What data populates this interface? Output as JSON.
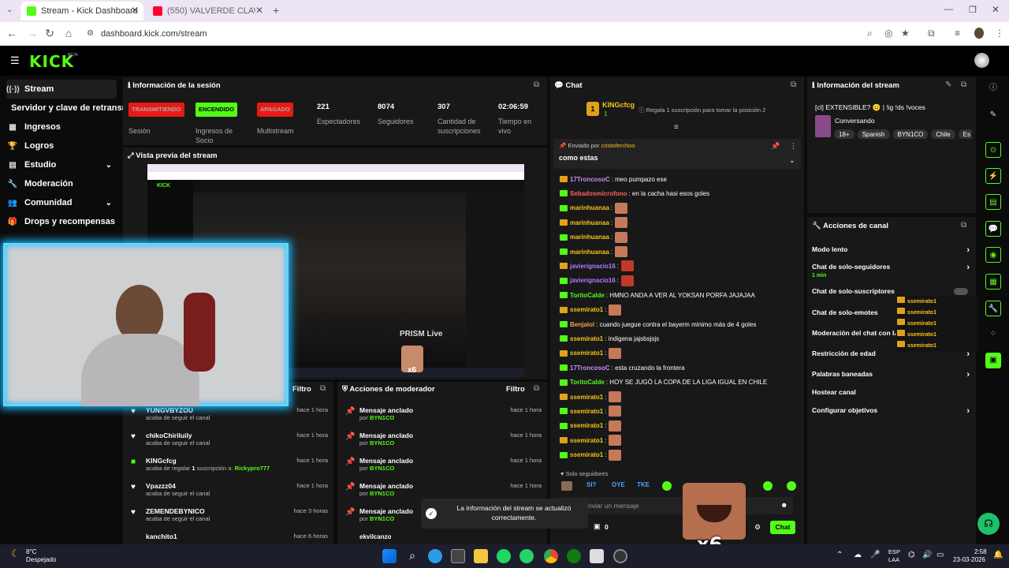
{
  "browser": {
    "tabs": [
      {
        "title": "Stream - Kick Dashboard",
        "active": true
      },
      {
        "title": "(550) VALVERDE CLAVÓ UN GO",
        "active": false
      }
    ],
    "url": "dashboard.kick.com/stream"
  },
  "brand": {
    "logo": "KICK",
    "beta": "BETA",
    "accent": "#53fc18"
  },
  "sidebar": {
    "items": [
      {
        "label": "Stream",
        "icon": "broadcast-icon"
      },
      {
        "label": "Servidor y clave de retransm",
        "icon": ""
      },
      {
        "label": "Ingresos",
        "icon": "grid-icon"
      },
      {
        "label": "Logros",
        "icon": "trophy-icon"
      },
      {
        "label": "Estudio",
        "icon": "studio-icon"
      },
      {
        "label": "Moderación",
        "icon": "wrench-icon"
      },
      {
        "label": "Comunidad",
        "icon": "community-icon"
      },
      {
        "label": "Drops y recompensas",
        "icon": "gift-icon"
      }
    ]
  },
  "session": {
    "title": "Información de la sesión",
    "stats": [
      {
        "badge": "TRANSMITIENDO",
        "badge_color": "#e91916",
        "label": "Sesión"
      },
      {
        "badge": "ENCENDIDO",
        "badge_color": "#53fc18",
        "label": "Ingresos de Socio"
      },
      {
        "badge": "APAGADO",
        "badge_color": "#e91916",
        "label": "Multistream"
      },
      {
        "value": "221",
        "label": "Espectadores"
      },
      {
        "value": "8074",
        "label": "Seguidores"
      },
      {
        "value": "307",
        "label": "Cantidad de suscripciones"
      },
      {
        "value": "02:06:59",
        "label": "Tiempo en vivo"
      }
    ]
  },
  "preview": {
    "title": "Vista previa del stream",
    "watermark": "PRISM Live",
    "emote_overlay": "x6"
  },
  "activity": {
    "filter_label": "Filtro",
    "items": [
      {
        "name": "YUNGVBYZOU",
        "text": "acaba de seguir el canal",
        "time": "hace 1 hora",
        "icon": "heart-icon"
      },
      {
        "name": "chikoChiriluily",
        "text": "acaba de seguir el canal",
        "time": "hace 1 hora",
        "icon": "heart-icon"
      },
      {
        "name": "KINGcfcg",
        "text": "acaba de regalar",
        "count": "1",
        "text2": "suscripción a:",
        "target": "Rickypro777",
        "time": "hace 1 hora",
        "icon": "gift-icon"
      },
      {
        "name": "Vpazzz04",
        "text": "acaba de seguir el canal",
        "time": "hace 1 hora",
        "icon": "heart-icon"
      },
      {
        "name": "ZEMENDEBYNICO",
        "text": "acaba de seguir el canal",
        "time": "hace 3 horas",
        "icon": "heart-icon"
      },
      {
        "name": "kanchito1",
        "text": "",
        "time": "hace 6 horas",
        "icon": "heart-icon"
      }
    ]
  },
  "mod_actions": {
    "title": "Acciones de moderador",
    "filter_label": "Filtro",
    "items": [
      {
        "action": "Mensaje anclado",
        "by": "por",
        "mod": "BYN1CO",
        "time": "hace 1 hora"
      },
      {
        "action": "Mensaje anclado",
        "by": "por",
        "mod": "BYN1CO",
        "time": "hace 1 hora"
      },
      {
        "action": "Mensaje anclado",
        "by": "por",
        "mod": "BYN1CO",
        "time": "hace 1 hora"
      },
      {
        "action": "Mensaje anclado",
        "by": "por",
        "mod": "BYN1CO",
        "time": "hace 1 hora"
      },
      {
        "action": "Mensaje anclado",
        "by": "por",
        "mod": "BYN1CO",
        "time": "hace 1 hora"
      },
      {
        "action": "",
        "by": "",
        "mod": "",
        "time": ""
      }
    ],
    "partial_user": "ekvilcanzo"
  },
  "chat": {
    "title": "Chat",
    "gifter": "KINGcfcg",
    "gifter_count": "1",
    "gift_prompt": "Regala 1 suscripción para tomar la posición 2",
    "pinned_label": "Enviado por",
    "pinned_user": "cristoferchoo",
    "pinned_text": "como estas",
    "messages": [
      {
        "user": "17TroncosoC",
        "color": "#c98cff",
        "text": ": meo pumpazo ese",
        "emote": false
      },
      {
        "user": "Sebadosmicrofono",
        "color": "#ff5f5f",
        "text": ": en la cacha hasi esos goles",
        "emote": false
      },
      {
        "user": "marinhuanaa",
        "color": "#f5c518",
        "text": ":",
        "emote": true
      },
      {
        "user": "marinhuanaa",
        "color": "#f5c518",
        "text": ":",
        "emote": true
      },
      {
        "user": "marinhuanaa",
        "color": "#f5c518",
        "text": ":",
        "emote": true
      },
      {
        "user": "marinhuanaa",
        "color": "#f5c518",
        "text": ":",
        "emote": true
      },
      {
        "user": "javierignacio16",
        "color": "#b27bff",
        "text": ":",
        "emote": true
      },
      {
        "user": "javierignacio16",
        "color": "#b27bff",
        "text": ":",
        "emote": true
      },
      {
        "user": "ToritoCalde",
        "color": "#53fc18",
        "text": ": HMNO ANDA A VER AL YOKSAN PORFA JAJAJAA",
        "emote": false
      },
      {
        "user": "ssemirato1",
        "color": "#f5c518",
        "text": ":",
        "emote": true
      },
      {
        "user": "Benjalol",
        "color": "#ff9f43",
        "text": ": cuando juegue contra el bayerm minimo más de 4 goles",
        "emote": false
      },
      {
        "user": "ssemirato1",
        "color": "#f5c518",
        "text": ": indigena jajsbsjsjs",
        "emote": false
      },
      {
        "user": "ssemirato1",
        "color": "#f5c518",
        "text": ":",
        "emote": true
      },
      {
        "user": "17TroncosoC",
        "color": "#c98cff",
        "text": ": esta cruzando la frontera",
        "emote": false
      },
      {
        "user": "ToritoCalde",
        "color": "#53fc18",
        "text": ": HOY SE JUGÓ LA COPA DE LA LIGA IGUAL EN CHILE",
        "emote": false
      },
      {
        "user": "ssemirato1",
        "color": "#f5c518",
        "text": ":",
        "emote": true
      },
      {
        "user": "ssemirato1",
        "color": "#f5c518",
        "text": ":",
        "emote": true
      },
      {
        "user": "ssemirato1",
        "color": "#f5c518",
        "text": ":",
        "emote": true
      },
      {
        "user": "ssemirato1",
        "color": "#f5c518",
        "text": ":",
        "emote": true
      },
      {
        "user": "ssemirato1",
        "color": "#f5c518",
        "text": ":",
        "emote": true
      }
    ],
    "followers_only_label": "Solo seguidores",
    "input_placeholder": "nviar un mensaje",
    "points": "0",
    "send_label": "Chat",
    "overlay_text": "x6"
  },
  "toast": {
    "text": "La información del stream se actualizó correctamente."
  },
  "stream_info": {
    "title_label": "Información del stream",
    "title": "[cl] EXTENSIBLE? 😐 | !ig !ds !voces",
    "category": "Conversando",
    "tags": [
      "18+",
      "Spanish",
      "BYN1CO",
      "Chile",
      "Es"
    ]
  },
  "channel_actions": {
    "title": "Acciones de canal",
    "items": [
      {
        "label": "Modo lento",
        "sub": "",
        "arrow": true
      },
      {
        "label": "Chat de solo-seguidores",
        "sub": "1 min",
        "arrow": true
      },
      {
        "label": "Chat de solo-suscriptores",
        "sub": "",
        "arrow": false
      },
      {
        "label": "Chat de solo-emotes",
        "sub": "",
        "arrow": false
      },
      {
        "label": "Moderación del chat con IA",
        "sub": "",
        "arrow": false
      },
      {
        "label": "Restricción de edad",
        "sub": "",
        "arrow": true
      },
      {
        "label": "Palabras baneadas",
        "sub": "",
        "arrow": true
      },
      {
        "label": "Hostear canal",
        "sub": "",
        "arrow": false
      },
      {
        "label": "Configurar objetivos",
        "sub": "",
        "arrow": true
      }
    ]
  },
  "taskbar": {
    "weather_temp": "8°C",
    "weather_desc": "Despejado",
    "lang": "ESP",
    "lang2": "LAA",
    "time": "2:58",
    "date": "23-03-2026"
  }
}
